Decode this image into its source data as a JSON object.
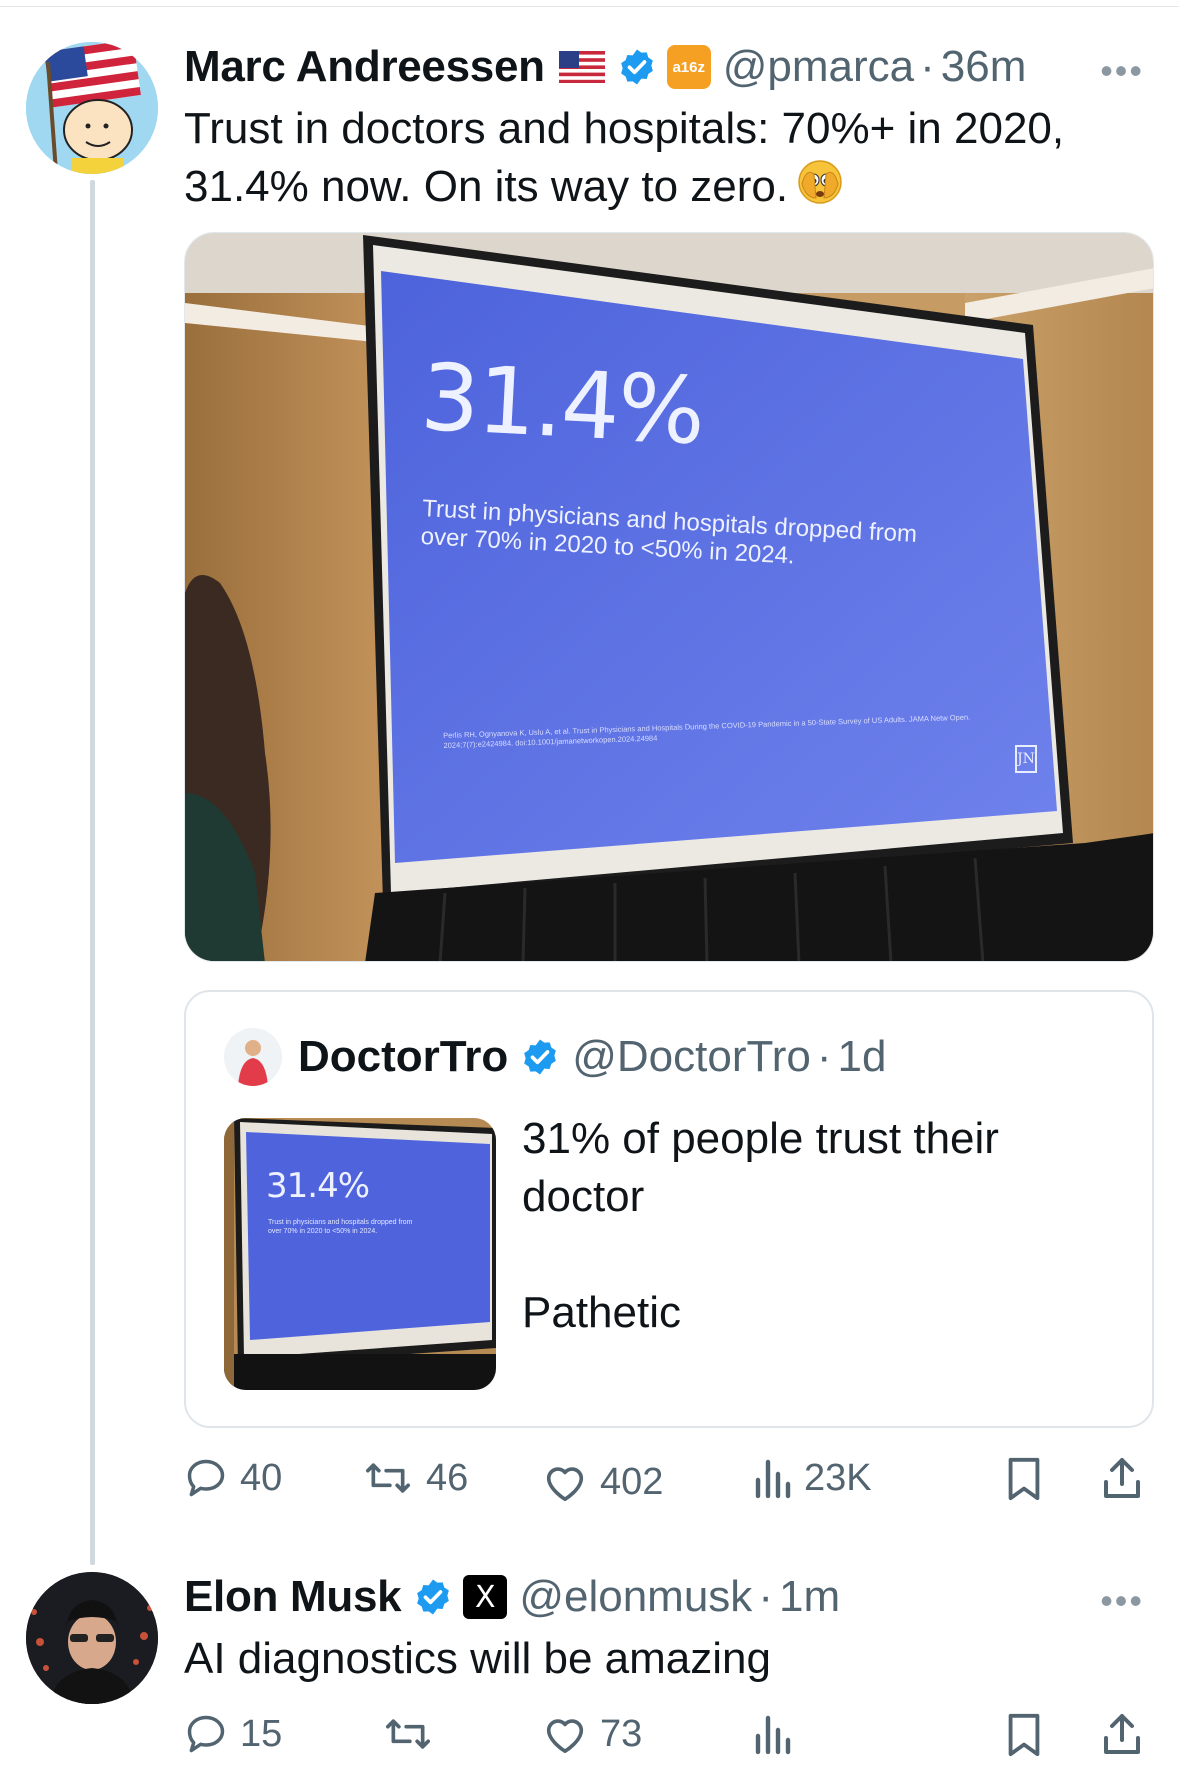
{
  "thread": {
    "tweet1": {
      "name": "Marc Andreessen",
      "affiliate_badge": "a16z",
      "handle": "@pmarca",
      "separator": "·",
      "time": "36m",
      "text_line1": "Trust in doctors and hospitals: 70%+ in 2020,",
      "text_line2": "31.4% now. On its way to zero.",
      "emoji": "face-with-open-eyes-and-hand-over-mouth",
      "media": {
        "slide_stat": "31.4%",
        "slide_caption_line1": "Trust in physicians and hospitals dropped from",
        "slide_caption_line2": "over 70% in 2020 to <50% in 2024.",
        "slide_citation_line1": "Perlis RH, Ognyanova K, Uslu A, et al. Trust in Physicians and Hospitals During the COVID-19 Pandemic in a 50-State Survey of US Adults. JAMA Netw Open.",
        "slide_citation_line2": "2024;7(7):e2424984. doi:10.1001/jamanetworkopen.2024.24984",
        "slide_bg": "#5a6fe0"
      },
      "quote": {
        "name": "DoctorTro",
        "handle": "@DoctorTro",
        "separator": "·",
        "time": "1d",
        "line1": "31% of people trust their",
        "line2": "doctor",
        "line3": "Pathetic",
        "thumb_stat": "31.4%",
        "thumb_caption_line1": "Trust in physicians and hospitals dropped from",
        "thumb_caption_line2": "over 70% in 2020 to <50% in 2024."
      },
      "actions": {
        "replies": "40",
        "reposts": "46",
        "likes": "402",
        "views": "23K"
      }
    },
    "tweet2": {
      "name": "Elon Musk",
      "affiliate_badge": "X",
      "handle": "@elonmusk",
      "separator": "·",
      "time": "1m",
      "text": "AI diagnostics will be amazing",
      "actions": {
        "replies": "15",
        "reposts": "",
        "likes": "73",
        "views": ""
      }
    }
  },
  "colors": {
    "verified": "#1d9bf0",
    "secondary_text": "#536471",
    "thread_line": "#cfd9de",
    "a16z_badge": "#f6a023"
  }
}
